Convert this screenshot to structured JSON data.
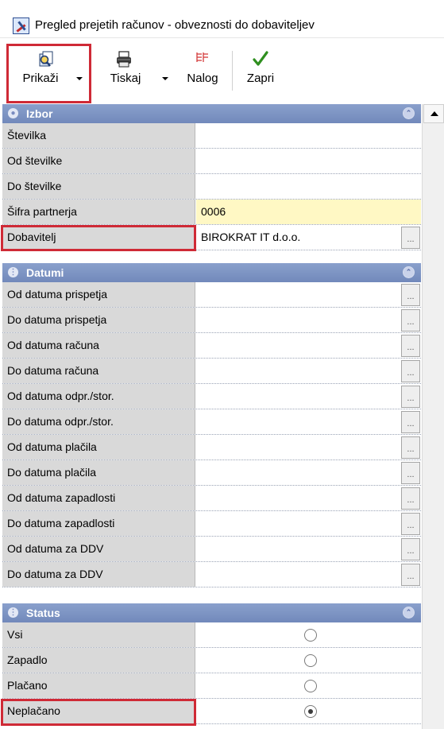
{
  "window": {
    "title": "Pregled prejetih računov - obveznosti do dobaviteljev",
    "icon": "report-chart-icon"
  },
  "toolbar": {
    "show": {
      "label": "Prikaži",
      "icon": "search-document-icon",
      "highlighted": true
    },
    "print": {
      "label": "Tiskaj",
      "icon": "printer-icon"
    },
    "order": {
      "label": "Nalog",
      "icon": "payment-order-icon"
    },
    "close": {
      "label": "Zapri",
      "icon": "checkmark-icon"
    }
  },
  "sections": {
    "izbor": {
      "title": "Izbor",
      "rows": [
        {
          "label": "Številka",
          "value": ""
        },
        {
          "label": "Od številke",
          "value": ""
        },
        {
          "label": "Do številke",
          "value": ""
        },
        {
          "label": "Šifra partnerja",
          "value": "0006"
        },
        {
          "label": "Dobavitelj",
          "value": "BIROKRAT IT d.o.o.",
          "button": "...",
          "highlighted": true
        }
      ]
    },
    "datumi": {
      "title": "Datumi",
      "rows": [
        {
          "label": "Od datuma prispetja",
          "value": "",
          "button": "..."
        },
        {
          "label": "Do datuma prispetja",
          "value": "",
          "button": "..."
        },
        {
          "label": "Od datuma računa",
          "value": "",
          "button": "..."
        },
        {
          "label": "Do datuma računa",
          "value": "",
          "button": "..."
        },
        {
          "label": "Od datuma odpr./stor.",
          "value": "",
          "button": "..."
        },
        {
          "label": "Do datuma odpr./stor.",
          "value": "",
          "button": "..."
        },
        {
          "label": "Od datuma plačila",
          "value": "",
          "button": "..."
        },
        {
          "label": "Do datuma plačila",
          "value": "",
          "button": "..."
        },
        {
          "label": "Od datuma zapadlosti",
          "value": "",
          "button": "..."
        },
        {
          "label": "Do datuma zapadlosti",
          "value": "",
          "button": "..."
        },
        {
          "label": "Od datuma za DDV",
          "value": "",
          "button": "..."
        },
        {
          "label": "Do datuma za DDV",
          "value": "",
          "button": "..."
        }
      ]
    },
    "status": {
      "title": "Status",
      "rows": [
        {
          "label": "Vsi",
          "selected": false
        },
        {
          "label": "Zapadlo",
          "selected": false
        },
        {
          "label": "Plačano",
          "selected": false
        },
        {
          "label": "Neplačano",
          "selected": true,
          "highlighted": true
        }
      ]
    }
  },
  "colors": {
    "section_header": "#7f95c4",
    "label_bg": "#d9d9d9",
    "partner_code_bg": "#fff8c4",
    "highlight": "#cf2a36"
  }
}
